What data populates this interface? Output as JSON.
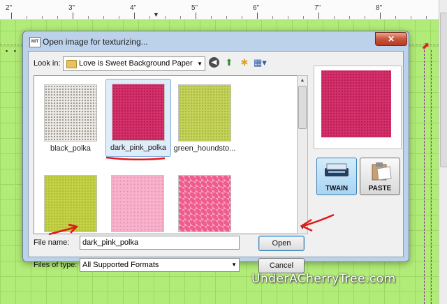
{
  "ruler": {
    "numbers": [
      "2\"",
      "3\"",
      "4\"",
      "5\"",
      "6\"",
      "7\"",
      "8\""
    ]
  },
  "dialog": {
    "title": "Open image for texturizing...",
    "close_symbol": "✕",
    "app_icon_text": "MIT",
    "look_in": {
      "label": "Look in:",
      "value": "Love is Sweet Background Paper Pac"
    },
    "toolbar_icons": [
      "back-icon",
      "up-folder-icon",
      "new-folder-icon",
      "view-menu-icon"
    ],
    "files": [
      {
        "name": "black_polka",
        "pattern": "black",
        "selected": false
      },
      {
        "name": "dark_pink_polka",
        "pattern": "darkpink",
        "selected": true
      },
      {
        "name": "green_houndsto...",
        "pattern": "green",
        "selected": false
      },
      {
        "name": "",
        "pattern": "lime",
        "selected": false
      },
      {
        "name": "",
        "pattern": "lightpink",
        "selected": false
      },
      {
        "name": "",
        "pattern": "pinkgeo",
        "selected": false
      }
    ],
    "file_name": {
      "label": "File name:",
      "value": "dark_pink_polka"
    },
    "files_of_type": {
      "label": "Files of type:",
      "value": "All Supported Formats"
    },
    "buttons": {
      "open": "Open",
      "cancel": "Cancel"
    },
    "side_buttons": {
      "twain": "TWAIN",
      "paste": "PASTE"
    }
  },
  "watermark": "UnderACherryTree.com",
  "colors": {
    "canvas_green": "#b2ec78",
    "dark_pink": "#d4306a",
    "annotation_red": "#e11919"
  }
}
